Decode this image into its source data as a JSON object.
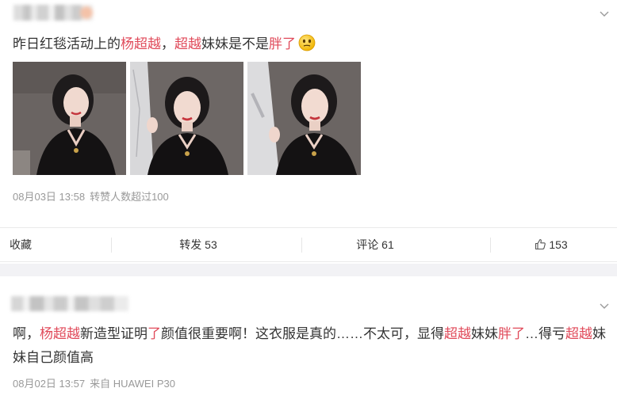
{
  "post1": {
    "text_parts": [
      "昨日红毯活动上的",
      "杨超越",
      "，",
      "超越",
      "妹妹是不是",
      "胖了"
    ],
    "emoji": "smiley-emoji",
    "images": [
      "photo-1",
      "photo-2",
      "photo-3"
    ],
    "date": "08月03日 13:58",
    "extra": "转赞人数超过100"
  },
  "actions": {
    "collect": "收藏",
    "forward": "转发 53",
    "comment": "评论 61",
    "like": "153"
  },
  "post2": {
    "text_parts": [
      "啊，",
      "杨超越",
      "新造型证明",
      "了",
      "颜值很重要啊！这衣服是真的……不太可，显得",
      "超越",
      "妹妹",
      "胖了",
      "…得亏",
      "超越",
      "妹妹自己颜值高"
    ],
    "date": "08月02日 13:57",
    "source": "来自 HUAWEI P30"
  },
  "colors": {
    "highlight": "#e04a5a",
    "meta": "#999999",
    "gap": "#f2f2f5"
  }
}
